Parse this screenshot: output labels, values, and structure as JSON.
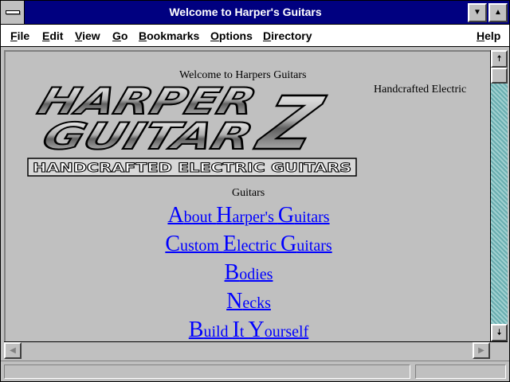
{
  "window": {
    "title": "Welcome to Harper's Guitars",
    "minimize_icon": "triangle-down",
    "maximize_icon": "triangle-up"
  },
  "menu": [
    {
      "label": "File"
    },
    {
      "label": "Edit"
    },
    {
      "label": "View"
    },
    {
      "label": "Go"
    },
    {
      "label": "Bookmarks"
    },
    {
      "label": "Options"
    },
    {
      "label": "Directory"
    },
    {
      "label": "Help"
    }
  ],
  "page": {
    "welcome": "Welcome to Harpers Guitars",
    "side_text": "Handcrafted Electric",
    "caption": "Guitars",
    "logo": {
      "line1": "HARPER",
      "line2": "GUITAR",
      "letter": "Z",
      "tagline": "HANDCRAFTED ELECTRIC GUITARS"
    },
    "links": [
      {
        "parts": [
          {
            "big": "A"
          },
          {
            "small": "bout "
          },
          {
            "big": "H"
          },
          {
            "small": "arper's "
          },
          {
            "big": "G"
          },
          {
            "small": "uitars "
          }
        ]
      },
      {
        "parts": [
          {
            "big": "C"
          },
          {
            "small": "ustom "
          },
          {
            "big": "E"
          },
          {
            "small": "lectric "
          },
          {
            "big": "G"
          },
          {
            "small": "uitars "
          }
        ]
      },
      {
        "parts": [
          {
            "big": "B"
          },
          {
            "small": "odies "
          }
        ]
      },
      {
        "parts": [
          {
            "big": "N"
          },
          {
            "small": "ecks "
          }
        ]
      },
      {
        "parts": [
          {
            "big": "B"
          },
          {
            "small": "uild "
          },
          {
            "big": "I"
          },
          {
            "small": "t "
          },
          {
            "big": "Y"
          },
          {
            "small": "ourself "
          }
        ]
      }
    ]
  },
  "colors": {
    "titlebar": "#000080",
    "link": "#0000ff",
    "background": "#c0c0c0"
  }
}
